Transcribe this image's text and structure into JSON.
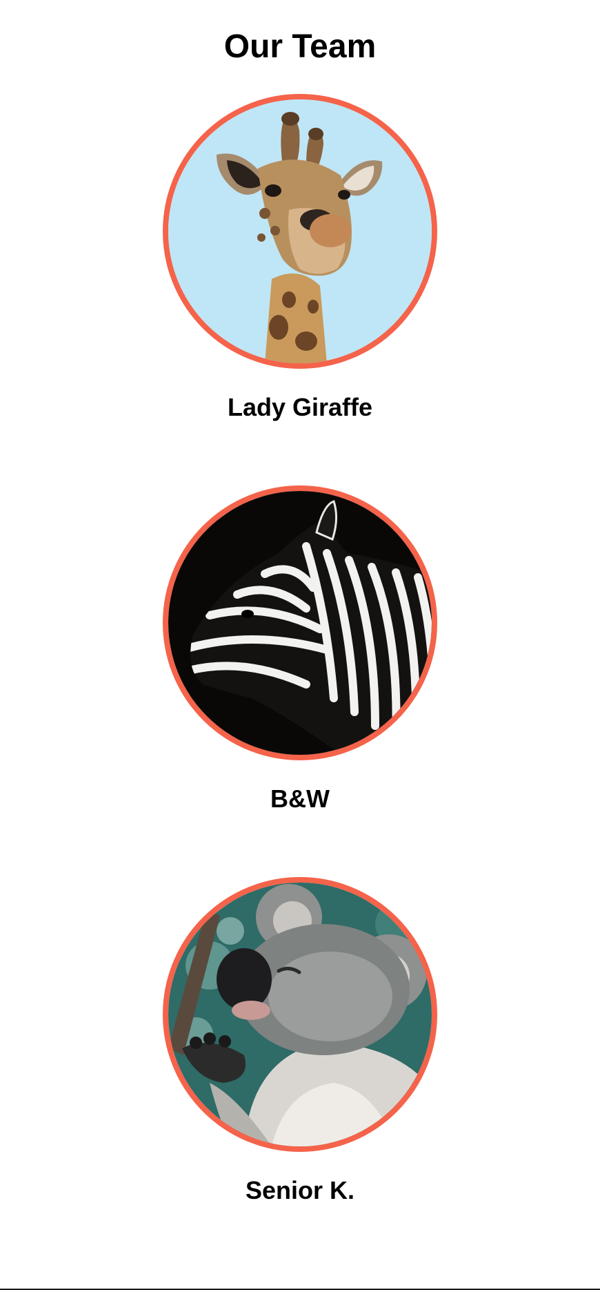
{
  "page": {
    "title": "Our Team"
  },
  "team": {
    "members": [
      {
        "name": "Lady Giraffe",
        "photo": "giraffe-photo"
      },
      {
        "name": "B&W",
        "photo": "zebra-photo"
      },
      {
        "name": "Senior K.",
        "photo": "koala-photo"
      }
    ]
  },
  "colors": {
    "avatar_border": "#f4634a",
    "text": "#000000",
    "background": "#ffffff"
  }
}
